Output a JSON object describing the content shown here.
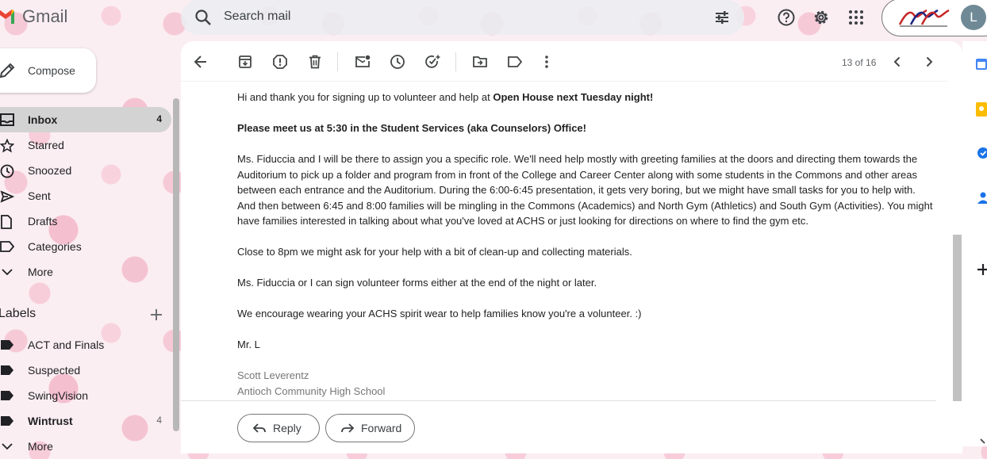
{
  "app": {
    "name": "Gmail"
  },
  "search": {
    "placeholder": "Search mail"
  },
  "account": {
    "initial": "L"
  },
  "compose": {
    "label": "Compose"
  },
  "nav": [
    {
      "label": "Inbox",
      "count": "4"
    },
    {
      "label": "Starred"
    },
    {
      "label": "Snoozed"
    },
    {
      "label": "Sent"
    },
    {
      "label": "Drafts"
    },
    {
      "label": "Categories"
    },
    {
      "label": "More"
    }
  ],
  "labels": {
    "heading": "Labels",
    "items": [
      {
        "label": "ACT and Finals"
      },
      {
        "label": "Suspected"
      },
      {
        "label": "SwingVision"
      },
      {
        "label": "Wintrust",
        "count": "4"
      },
      {
        "label": "More"
      }
    ]
  },
  "pager": {
    "text": "13 of 16"
  },
  "email": {
    "greeting_prefix": "Hi and thank you for signing up to volunteer and help at ",
    "greeting_bold": "Open House next Tuesday night!",
    "meet": "Please meet us at 5:30 in the Student Services (aka Counselors) Office!",
    "para1": "Ms. Fiduccia and I will be there to assign you a specific role.  We'll need help mostly with greeting families at the doors and directing them towards the Auditorium to pick up a folder and program from in front of the College and Career Center along with some students in the Commons and other areas between each entrance and the Auditorium.  During the 6:00-6:45 presentation, it gets very boring, but we might have small tasks for you to help with.  And then between 6:45 and 8:00 families will be mingling in the Commons (Academics) and North Gym (Athletics) and South Gym (Activities).  You might have families interested in talking about what you've loved at ACHS or just looking for directions on where to find the gym etc.",
    "para2": "Close to 8pm we might ask for your help with a bit of clean-up and collecting materials.",
    "para3": "Ms. Fiduccia or I can sign volunteer forms either at the end of the night or later.",
    "para4": "We encourage wearing your ACHS spirit wear to help families know you're a volunteer.  :)",
    "signoff": "Mr. L",
    "sig_name": "Scott Leverentz",
    "sig_org": "Antioch Community High School"
  },
  "actions": {
    "reply": "Reply",
    "forward": "Forward"
  },
  "colors": {
    "accent": "#0b57d0",
    "active_nav": "#d3d3d3",
    "gmail_red": "#ea4335"
  }
}
